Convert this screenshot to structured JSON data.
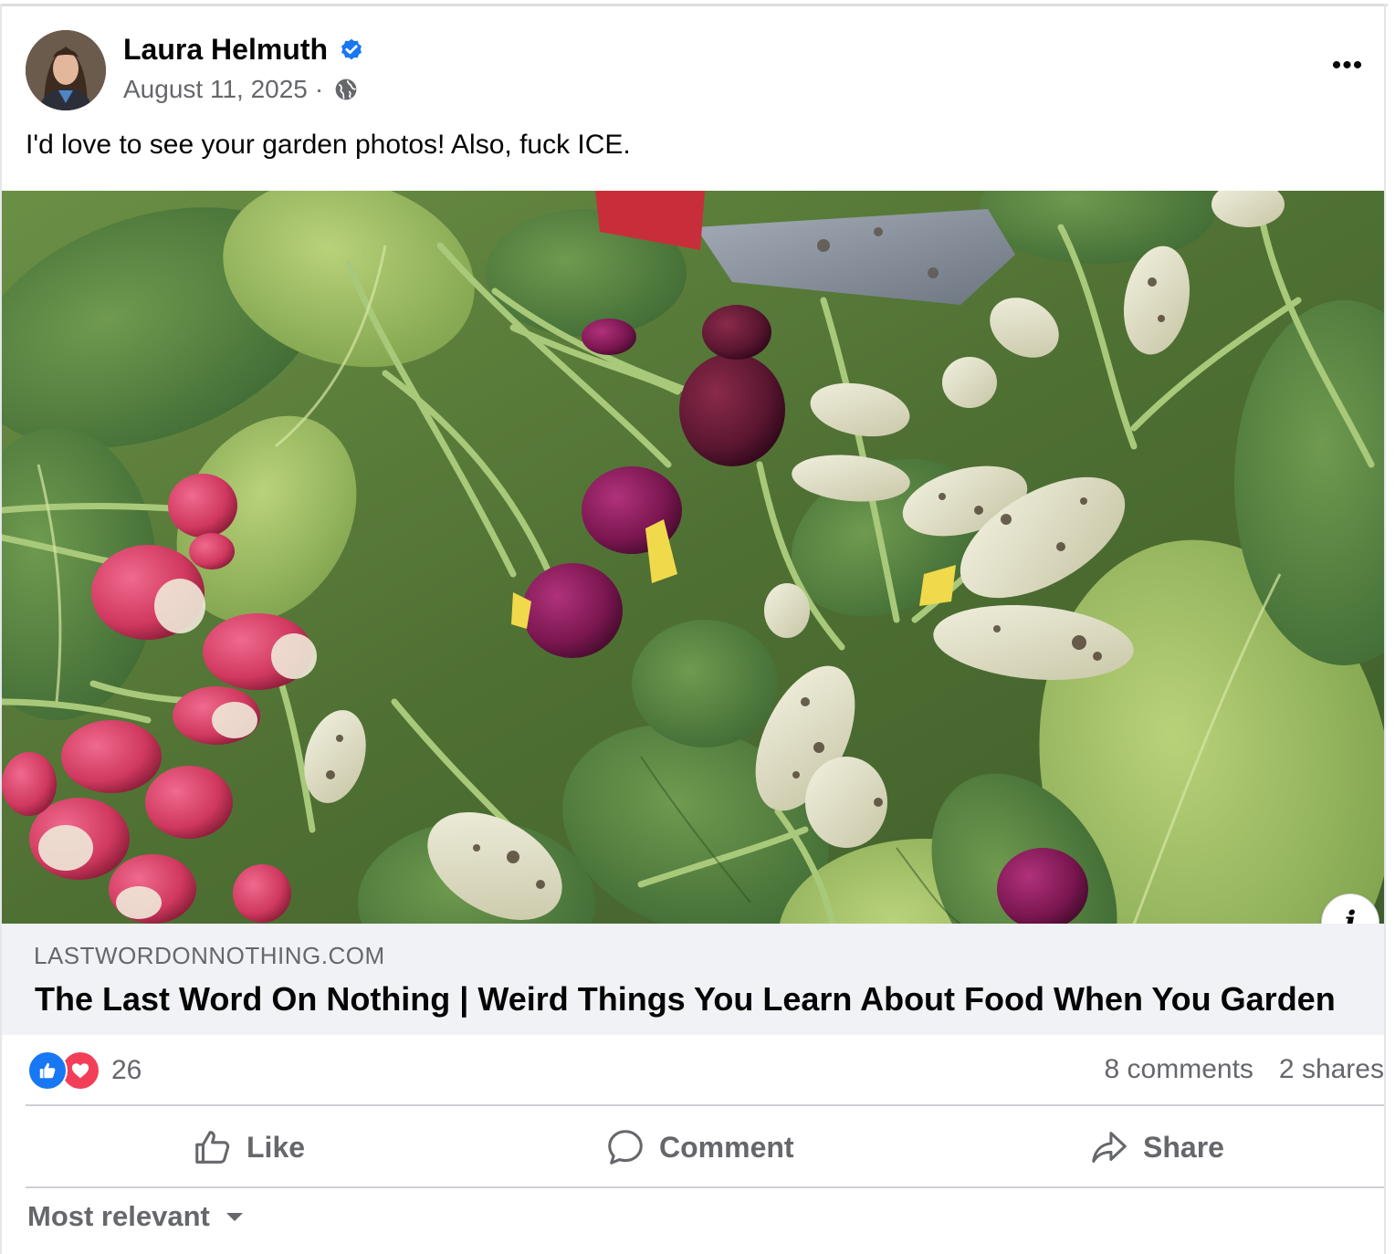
{
  "post": {
    "author": "Laura Helmuth",
    "date": "August 11, 2025",
    "separator": "·",
    "text": "I'd love to see your garden photos! Also, fuck ICE.",
    "more_label": "•••"
  },
  "link_preview": {
    "domain": "LASTWORDONNOTHING.COM",
    "title": "The Last Word On Nothing | Weird Things You Learn About Food When You Garden",
    "info_label": "i"
  },
  "engagement": {
    "reaction_count": "26",
    "comments": "8 comments",
    "shares": "2 shares"
  },
  "actions": {
    "like": "Like",
    "comment": "Comment",
    "share": "Share"
  },
  "comments_sort": {
    "label": "Most relevant"
  },
  "colors": {
    "like_blue": "#1877f2",
    "love_red": "#f33e58",
    "secondary_text": "#65676b",
    "link_box_bg": "#f0f2f5"
  },
  "icons": [
    "verified-badge-icon",
    "globe-icon",
    "more-options-icon",
    "info-icon",
    "like-reaction-icon",
    "love-reaction-icon",
    "thumbs-up-icon",
    "comment-bubble-icon",
    "share-arrow-icon",
    "caret-down-icon"
  ]
}
